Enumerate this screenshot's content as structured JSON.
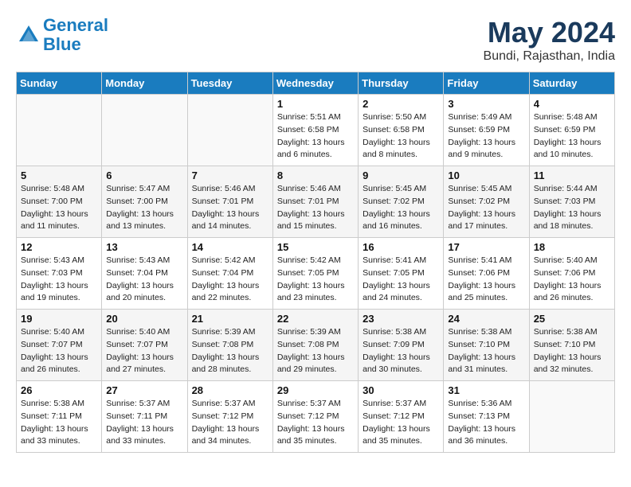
{
  "header": {
    "logo_line1": "General",
    "logo_line2": "Blue",
    "month_title": "May 2024",
    "subtitle": "Bundi, Rajasthan, India"
  },
  "days_of_week": [
    "Sunday",
    "Monday",
    "Tuesday",
    "Wednesday",
    "Thursday",
    "Friday",
    "Saturday"
  ],
  "weeks": [
    [
      {
        "num": "",
        "info": ""
      },
      {
        "num": "",
        "info": ""
      },
      {
        "num": "",
        "info": ""
      },
      {
        "num": "1",
        "info": "Sunrise: 5:51 AM\nSunset: 6:58 PM\nDaylight: 13 hours\nand 6 minutes."
      },
      {
        "num": "2",
        "info": "Sunrise: 5:50 AM\nSunset: 6:58 PM\nDaylight: 13 hours\nand 8 minutes."
      },
      {
        "num": "3",
        "info": "Sunrise: 5:49 AM\nSunset: 6:59 PM\nDaylight: 13 hours\nand 9 minutes."
      },
      {
        "num": "4",
        "info": "Sunrise: 5:48 AM\nSunset: 6:59 PM\nDaylight: 13 hours\nand 10 minutes."
      }
    ],
    [
      {
        "num": "5",
        "info": "Sunrise: 5:48 AM\nSunset: 7:00 PM\nDaylight: 13 hours\nand 11 minutes."
      },
      {
        "num": "6",
        "info": "Sunrise: 5:47 AM\nSunset: 7:00 PM\nDaylight: 13 hours\nand 13 minutes."
      },
      {
        "num": "7",
        "info": "Sunrise: 5:46 AM\nSunset: 7:01 PM\nDaylight: 13 hours\nand 14 minutes."
      },
      {
        "num": "8",
        "info": "Sunrise: 5:46 AM\nSunset: 7:01 PM\nDaylight: 13 hours\nand 15 minutes."
      },
      {
        "num": "9",
        "info": "Sunrise: 5:45 AM\nSunset: 7:02 PM\nDaylight: 13 hours\nand 16 minutes."
      },
      {
        "num": "10",
        "info": "Sunrise: 5:45 AM\nSunset: 7:02 PM\nDaylight: 13 hours\nand 17 minutes."
      },
      {
        "num": "11",
        "info": "Sunrise: 5:44 AM\nSunset: 7:03 PM\nDaylight: 13 hours\nand 18 minutes."
      }
    ],
    [
      {
        "num": "12",
        "info": "Sunrise: 5:43 AM\nSunset: 7:03 PM\nDaylight: 13 hours\nand 19 minutes."
      },
      {
        "num": "13",
        "info": "Sunrise: 5:43 AM\nSunset: 7:04 PM\nDaylight: 13 hours\nand 20 minutes."
      },
      {
        "num": "14",
        "info": "Sunrise: 5:42 AM\nSunset: 7:04 PM\nDaylight: 13 hours\nand 22 minutes."
      },
      {
        "num": "15",
        "info": "Sunrise: 5:42 AM\nSunset: 7:05 PM\nDaylight: 13 hours\nand 23 minutes."
      },
      {
        "num": "16",
        "info": "Sunrise: 5:41 AM\nSunset: 7:05 PM\nDaylight: 13 hours\nand 24 minutes."
      },
      {
        "num": "17",
        "info": "Sunrise: 5:41 AM\nSunset: 7:06 PM\nDaylight: 13 hours\nand 25 minutes."
      },
      {
        "num": "18",
        "info": "Sunrise: 5:40 AM\nSunset: 7:06 PM\nDaylight: 13 hours\nand 26 minutes."
      }
    ],
    [
      {
        "num": "19",
        "info": "Sunrise: 5:40 AM\nSunset: 7:07 PM\nDaylight: 13 hours\nand 26 minutes."
      },
      {
        "num": "20",
        "info": "Sunrise: 5:40 AM\nSunset: 7:07 PM\nDaylight: 13 hours\nand 27 minutes."
      },
      {
        "num": "21",
        "info": "Sunrise: 5:39 AM\nSunset: 7:08 PM\nDaylight: 13 hours\nand 28 minutes."
      },
      {
        "num": "22",
        "info": "Sunrise: 5:39 AM\nSunset: 7:08 PM\nDaylight: 13 hours\nand 29 minutes."
      },
      {
        "num": "23",
        "info": "Sunrise: 5:38 AM\nSunset: 7:09 PM\nDaylight: 13 hours\nand 30 minutes."
      },
      {
        "num": "24",
        "info": "Sunrise: 5:38 AM\nSunset: 7:10 PM\nDaylight: 13 hours\nand 31 minutes."
      },
      {
        "num": "25",
        "info": "Sunrise: 5:38 AM\nSunset: 7:10 PM\nDaylight: 13 hours\nand 32 minutes."
      }
    ],
    [
      {
        "num": "26",
        "info": "Sunrise: 5:38 AM\nSunset: 7:11 PM\nDaylight: 13 hours\nand 33 minutes."
      },
      {
        "num": "27",
        "info": "Sunrise: 5:37 AM\nSunset: 7:11 PM\nDaylight: 13 hours\nand 33 minutes."
      },
      {
        "num": "28",
        "info": "Sunrise: 5:37 AM\nSunset: 7:12 PM\nDaylight: 13 hours\nand 34 minutes."
      },
      {
        "num": "29",
        "info": "Sunrise: 5:37 AM\nSunset: 7:12 PM\nDaylight: 13 hours\nand 35 minutes."
      },
      {
        "num": "30",
        "info": "Sunrise: 5:37 AM\nSunset: 7:12 PM\nDaylight: 13 hours\nand 35 minutes."
      },
      {
        "num": "31",
        "info": "Sunrise: 5:36 AM\nSunset: 7:13 PM\nDaylight: 13 hours\nand 36 minutes."
      },
      {
        "num": "",
        "info": ""
      }
    ]
  ]
}
